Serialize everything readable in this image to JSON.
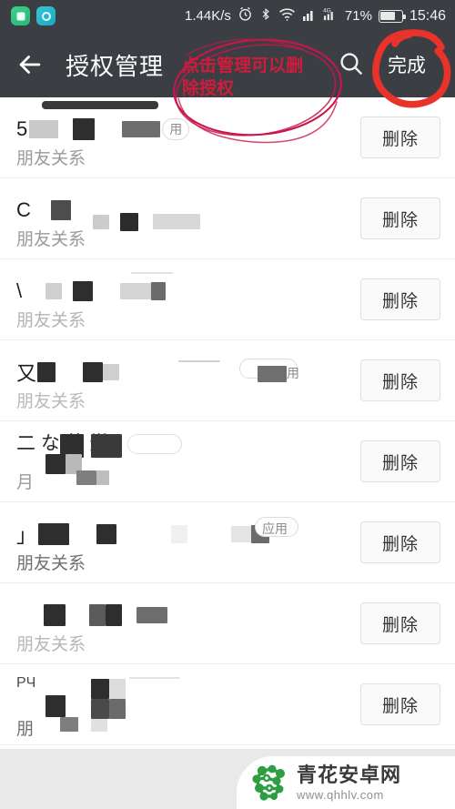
{
  "statusbar": {
    "app_icons": [
      "green-app-icon",
      "cyan-app-icon"
    ],
    "network_speed": "1.44K/s",
    "icons": [
      "alarm-icon",
      "bluetooth-icon",
      "wifi-icon",
      "signal-bars-icon",
      "4g-signal-icon"
    ],
    "fourg_label": "4G",
    "battery_percent": "71%",
    "time": "15:46"
  },
  "toolbar": {
    "back_icon": "back-arrow-icon",
    "title": "授权管理",
    "search_icon": "search-icon",
    "done_label": "完成"
  },
  "annotation": {
    "text": "点击管理可以删除授权",
    "color": "#d01c3c",
    "circle_color": "#e8322a"
  },
  "list": {
    "delete_label": "删除",
    "rows": [
      {
        "title_prefix": "5",
        "subtitle": "朋友关系",
        "tag": "用",
        "redacted": true
      },
      {
        "title_prefix": "C",
        "subtitle": "朋友关系",
        "tag": "",
        "redacted": true
      },
      {
        "title_prefix": "\\",
        "subtitle": "朋友关系",
        "tag": "",
        "redacted": true
      },
      {
        "title_prefix": "又",
        "subtitle": "朋友关系",
        "tag": "用",
        "redacted": true
      },
      {
        "title_prefix": "二 な 芸 燃",
        "subtitle": "月",
        "tag": "",
        "redacted": true
      },
      {
        "title_prefix": "」",
        "subtitle": "朋友关系",
        "tag": "应用",
        "redacted": true
      },
      {
        "title_prefix": "",
        "subtitle": "朋友关系",
        "tag": "",
        "redacted": true
      },
      {
        "title_prefix": "РЧ",
        "subtitle": "朋",
        "tag": "",
        "redacted": true
      }
    ]
  },
  "footer": {
    "watermark_name": "青花安卓网",
    "watermark_url": "www.qhhlv.com",
    "logo_icon": "qinghua-logo-icon"
  }
}
